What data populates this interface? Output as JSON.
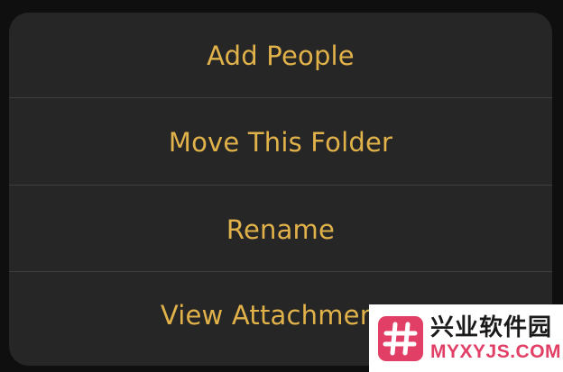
{
  "menu": {
    "items": [
      {
        "label": "Add People"
      },
      {
        "label": "Move This Folder"
      },
      {
        "label": "Rename"
      },
      {
        "label": "View Attachments"
      }
    ],
    "text_color": "#e2b24a",
    "background_color": "#262626"
  },
  "watermark": {
    "icon": "hash-logo-icon",
    "brand_cn": "兴业软件园",
    "brand_en": "MYXYJS.COM",
    "accent_color": "#e23f67"
  }
}
